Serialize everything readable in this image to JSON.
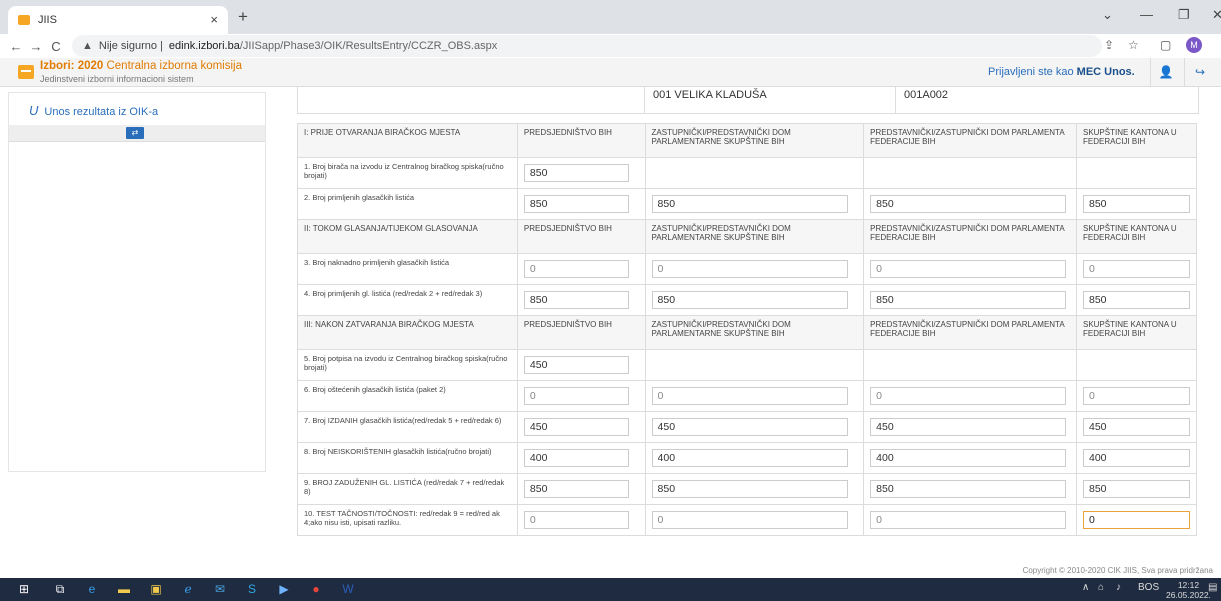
{
  "browser": {
    "tab_title": "JIIS",
    "tab_close": "×",
    "new_tab": "+",
    "win_min": "—",
    "win_max": "❐",
    "win_close": "✕",
    "back": "←",
    "forward": "→",
    "reload": "C",
    "warning": "▲",
    "insecure_label": "Nije sigurno |",
    "host": "edink.izbori.ba",
    "path": "/JIISapp/Phase3/OIK/ResultsEntry/CCZR_OBS.aspx",
    "profile": "M"
  },
  "header": {
    "title_bold": "Izbori: 2020",
    "title_rest": " Centralna izborna komisija",
    "subtitle": "Jedinstveni izborni informacioni sistem",
    "logged_prefix": "Prijavljeni ste kao ",
    "logged_user": "MEC Unos."
  },
  "sidebar": {
    "item_icon": "U",
    "item_label": "Unos rezultata iz OIK-a"
  },
  "info": {
    "municipality": "001 VELIKA KLADUŠA",
    "code": "001A002"
  },
  "columns": [
    "PREDSJEDNIŠTVO BIH",
    "ZASTUPNIČKI/PREDSTAVNIČKI DOM PARLAMENTARNE SKUPŠTINE BIH",
    "PREDSTAVNIČKI/ZASTUPNIČKI DOM PARLAMENTA FEDERACIJE BIH",
    "SKUPŠTINE KANTONA U FEDERACIJI BIH"
  ],
  "sections": {
    "s1": "I: PRIJE OTVARANJA BIRAČKOG MJESTA",
    "s2": "II: TOKOM GLASANJA/TIJEKOM GLASOVANJA",
    "s3": "III: NAKON ZATVARANJA BIRAČKOG MJESTA"
  },
  "rows": {
    "r1": {
      "label": "1. Broj birača na izvodu iz Centralnog biračkog spiska(ručno brojati)",
      "v0": "850"
    },
    "r2": {
      "label": "2. Broj primljenih glasačkih listića",
      "v0": "850",
      "v1": "850",
      "v2": "850",
      "v3": "850"
    },
    "r3": {
      "label": "3. Broj naknadno primljenih glasačkih listića",
      "v0": "0",
      "v1": "0",
      "v2": "0",
      "v3": "0"
    },
    "r4": {
      "label": "4. Broj primljenih gl. listića (red/redak 2 + red/redak 3)",
      "v0": "850",
      "v1": "850",
      "v2": "850",
      "v3": "850"
    },
    "r5": {
      "label": "5. Broj potpisa na izvodu iz Centralnog biračkog spiska(ručno brojati)",
      "v0": "450"
    },
    "r6": {
      "label": "6. Broj oštećenih glasačkih listića (paket 2)",
      "v0": "0",
      "v1": "0",
      "v2": "0",
      "v3": "0"
    },
    "r7": {
      "label": "7. Broj IZDANIH glasačkih listića(red/redak 5 + red/redak 6)",
      "v0": "450",
      "v1": "450",
      "v2": "450",
      "v3": "450"
    },
    "r8": {
      "label": "8. Broj NEISKORIŠTENIH glasačkih listića(ručno brojati)",
      "v0": "400",
      "v1": "400",
      "v2": "400",
      "v3": "400"
    },
    "r9": {
      "label": "9. BROJ ZADUŽENIH GL. LISTIĆA (red/redak 7 + red/redak 8)",
      "v0": "850",
      "v1": "850",
      "v2": "850",
      "v3": "850"
    },
    "r10": {
      "label": "10. TEST TAČNOSTI/TOČNOSTI: red/redak 9 = red/red ak 4;ako nisu isti, upisati razliku.",
      "v0": "0",
      "v1": "0",
      "v2": "0",
      "v3": "0"
    }
  },
  "footer": {
    "copyright": "Copyright © 2010-2020 CIK JIIS, Sva prava pridržana"
  },
  "taskbar": {
    "lang": "BOS",
    "time": "12:12",
    "date": "26.05.2022."
  },
  "colors": {
    "accent_orange": "#e07b00",
    "link_blue": "#2a6ebb",
    "taskbar": "#1f2b40"
  }
}
